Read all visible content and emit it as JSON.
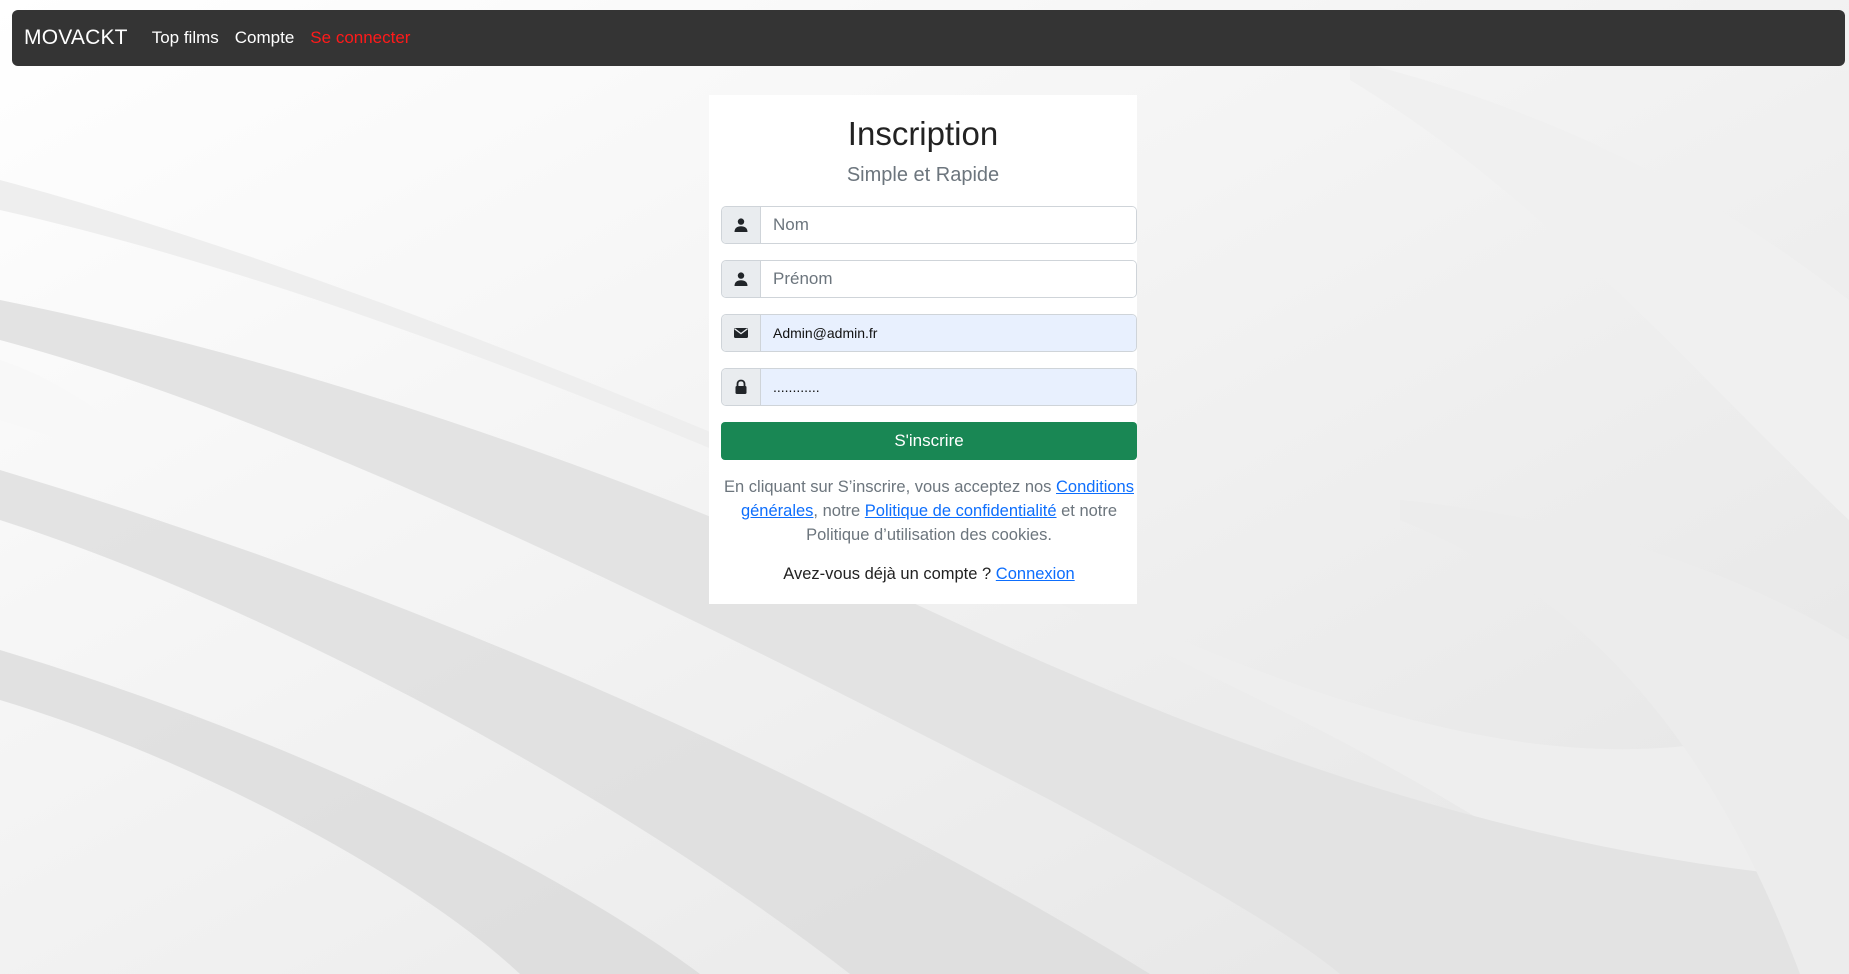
{
  "navbar": {
    "brand": "MOVACKT",
    "links": [
      {
        "label": "Top films"
      },
      {
        "label": "Compte"
      },
      {
        "label": "Se connecter",
        "color": "#ff1a1a"
      }
    ]
  },
  "form": {
    "title": "Inscription",
    "subtitle": "Simple et Rapide",
    "fields": [
      {
        "icon": "user-icon",
        "placeholder": "Nom",
        "value": ""
      },
      {
        "icon": "user-icon",
        "placeholder": "Prénom",
        "value": ""
      },
      {
        "icon": "envelope-icon",
        "placeholder": "",
        "value": "Admin@admin.fr"
      },
      {
        "icon": "lock-icon",
        "placeholder": "",
        "value": "............"
      }
    ],
    "submit_label": "S'inscrire",
    "terms": {
      "prefix": "En cliquant sur S’inscrire, vous acceptez nos ",
      "conditions_link": "Conditions générales",
      "middle": ", notre ",
      "privacy_link": "Politique de confidentialité",
      "suffix": " et notre Politique d’utilisation des cookies."
    },
    "login_prompt": {
      "text": "Avez-vous déjà un compte ? ",
      "link": "Connexion"
    }
  },
  "colors": {
    "navbar_bg": "#343434",
    "danger_link": "#ff1a1a",
    "success_button": "#198754",
    "link": "#0d6efd",
    "autofill_bg": "#e8f0fe"
  }
}
